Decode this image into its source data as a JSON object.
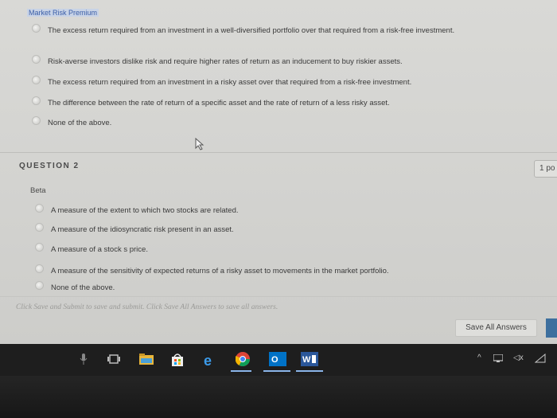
{
  "question1": {
    "term": "Market Risk Premium",
    "options": [
      "The excess return required from an investment in a well-diversified portfolio over that required from a risk-free investment.",
      "Risk-averse investors dislike risk and require higher rates of return as an inducement to buy riskier assets.",
      "The excess return required from an investment in a risky asset over that required from a risk-free investment.",
      "The difference between the rate of return of a specific asset and the rate of return of a less risky asset.",
      "None of the above."
    ]
  },
  "question2": {
    "header": "QUESTION 2",
    "points": "1 po",
    "term": "Beta",
    "options": [
      "A measure of the extent to which two stocks are related.",
      "A measure of the idiosyncratic risk present in an asset.",
      "A measure of a stock s price.",
      "A measure of the sensitivity of expected returns of a risky asset to movements in the market portfolio.",
      "None of the above."
    ]
  },
  "footer": {
    "instructions": "Click Save and Submit to save and submit. Click Save All Answers to save all answers.",
    "save_all_label": "Save All Answers"
  },
  "taskbar": {
    "icons": [
      "microphone-icon",
      "task-view-icon",
      "file-explorer-icon",
      "store-icon",
      "edge-icon",
      "chrome-icon",
      "outlook-icon",
      "word-icon"
    ],
    "outlook_badge": "O",
    "word_badge": "W"
  },
  "tray": {
    "icons": [
      "chevron-up-icon",
      "network-icon",
      "volume-muted-icon",
      "wifi-icon"
    ],
    "chevron": "^",
    "volume": "◁x"
  }
}
